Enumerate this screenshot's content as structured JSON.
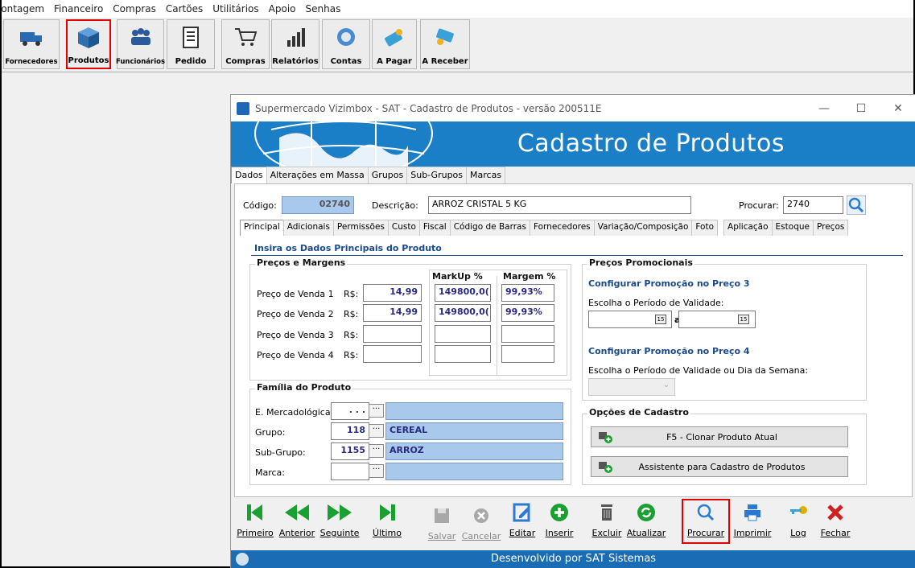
{
  "menu": [
    "lontagem",
    "Financeiro",
    "Compras",
    "Cartões",
    "Utilitários",
    "Apoio",
    "Senhas"
  ],
  "toolbar": [
    {
      "label": "Fornecedores",
      "icon": "truck-icon"
    },
    {
      "label": "Produtos",
      "icon": "box-icon"
    },
    {
      "label": "Funcionários",
      "icon": "people-icon"
    },
    {
      "label": "Pedido",
      "icon": "clipboard-icon"
    },
    {
      "label": "Compras",
      "icon": "cart-icon"
    },
    {
      "label": "Relatórios",
      "icon": "chart-icon"
    },
    {
      "label": "Contas",
      "icon": "coin-icon"
    },
    {
      "label": "A Pagar",
      "icon": "pay-icon"
    },
    {
      "label": "A Receber",
      "icon": "receive-icon"
    }
  ],
  "window": {
    "title": "Supermercado Vizimbox - SAT - Cadastro de Produtos - versão 200511E",
    "minimize": "—",
    "maximize": "☐",
    "close": "✕",
    "banner_title": "Cadastro de Produtos"
  },
  "tabs_top": [
    "Dados",
    "Alterações em Massa",
    "Grupos",
    "Sub-Grupos",
    "Marcas"
  ],
  "form": {
    "codigo_label": "Código:",
    "codigo_value": "02740",
    "descricao_label": "Descrição:",
    "descricao_value": "ARROZ CRISTAL 5 KG",
    "procurar_label": "Procurar:",
    "procurar_value": "2740"
  },
  "tabs_inner": [
    "Principal",
    "Adicionais",
    "Permissões",
    "Custo",
    "Fiscal",
    "Código de Barras",
    "Fornecedores",
    "Variação/Composição",
    "Foto",
    "Aplicação",
    "Estoque",
    "Preços"
  ],
  "section_title": "Insira os Dados Principais do Produto",
  "precos": {
    "title": "Preços e Margens",
    "markup_header": "MarkUp %",
    "margem_header": "Margem %",
    "rows": [
      {
        "label": "Preço de Venda 1",
        "cur": "R$:",
        "price": "14,99",
        "markup": "149800,0(",
        "margem": "99,93%"
      },
      {
        "label": "Preço de Venda 2",
        "cur": "R$:",
        "price": "14,99",
        "markup": "149800,0(",
        "margem": "99,93%"
      },
      {
        "label": "Preço de Venda 3",
        "cur": "R$:",
        "price": "",
        "markup": "",
        "margem": ""
      },
      {
        "label": "Preço de Venda 4",
        "cur": "R$:",
        "price": "",
        "markup": "",
        "margem": ""
      }
    ]
  },
  "familia": {
    "title": "Família do Produto",
    "rows": [
      {
        "label": "E. Mercadológica:",
        "code": ". . .",
        "name": ""
      },
      {
        "label": "Grupo:",
        "code": "118",
        "name": "CEREAL"
      },
      {
        "label": "Sub-Grupo:",
        "code": "1155",
        "name": "ARROZ"
      },
      {
        "label": "Marca:",
        "code": "",
        "name": ""
      }
    ],
    "ellipsis": "···"
  },
  "promo": {
    "title": "Preços Promocionais",
    "p3_title": "Configurar Promoção no Preço 3",
    "p3_label": "Escolha o Período de Validade:",
    "a": "a",
    "cal": "15",
    "p4_title": "Configurar Promoção no Preço 4",
    "p4_label": "Escolha o Período de Validade ou Dia da Semana:"
  },
  "opcoes": {
    "title": "Opções de Cadastro",
    "clone": "F5 - Clonar Produto Atual",
    "assist": "Assistente para Cadastro de Produtos"
  },
  "nav": [
    {
      "label": "Primeiro",
      "icon": "first-icon",
      "color": "#1aa030",
      "disabled": false
    },
    {
      "label": "Anterior",
      "icon": "prev-icon",
      "color": "#1aa030",
      "disabled": false
    },
    {
      "label": "Seguinte",
      "icon": "next-icon",
      "color": "#1aa030",
      "disabled": false
    },
    {
      "label": "Último",
      "icon": "last-icon",
      "color": "#1aa030",
      "disabled": false
    },
    {
      "label": "Salvar",
      "icon": "save-icon",
      "color": "#9a9a9a",
      "disabled": true
    },
    {
      "label": "Cancelar",
      "icon": "cancel-icon",
      "color": "#9a9a9a",
      "disabled": true
    },
    {
      "label": "Editar",
      "icon": "edit-icon",
      "color": "#2a7ad0",
      "disabled": false
    },
    {
      "label": "Inserir",
      "icon": "add-icon",
      "color": "#1aa030",
      "disabled": false
    },
    {
      "label": "Excluir",
      "icon": "trash-icon",
      "color": "#555555",
      "disabled": false
    },
    {
      "label": "Atualizar",
      "icon": "refresh-icon",
      "color": "#1aa030",
      "disabled": false
    },
    {
      "label": "Procurar",
      "icon": "search-icon",
      "color": "#2a7ad0",
      "disabled": false
    },
    {
      "label": "Imprimir",
      "icon": "print-icon",
      "color": "#2a7ad0",
      "disabled": false
    },
    {
      "label": "Log",
      "icon": "key-icon",
      "color": "#d0a000",
      "disabled": false
    },
    {
      "label": "Fechar",
      "icon": "close-icon",
      "color": "#d02020",
      "disabled": false
    }
  ],
  "footer": "Desenvolvido por SAT Sistemas",
  "colors": {
    "accent": "#1a7fc7",
    "highlight": "#e00000",
    "field_blue": "#a8c8ec"
  }
}
